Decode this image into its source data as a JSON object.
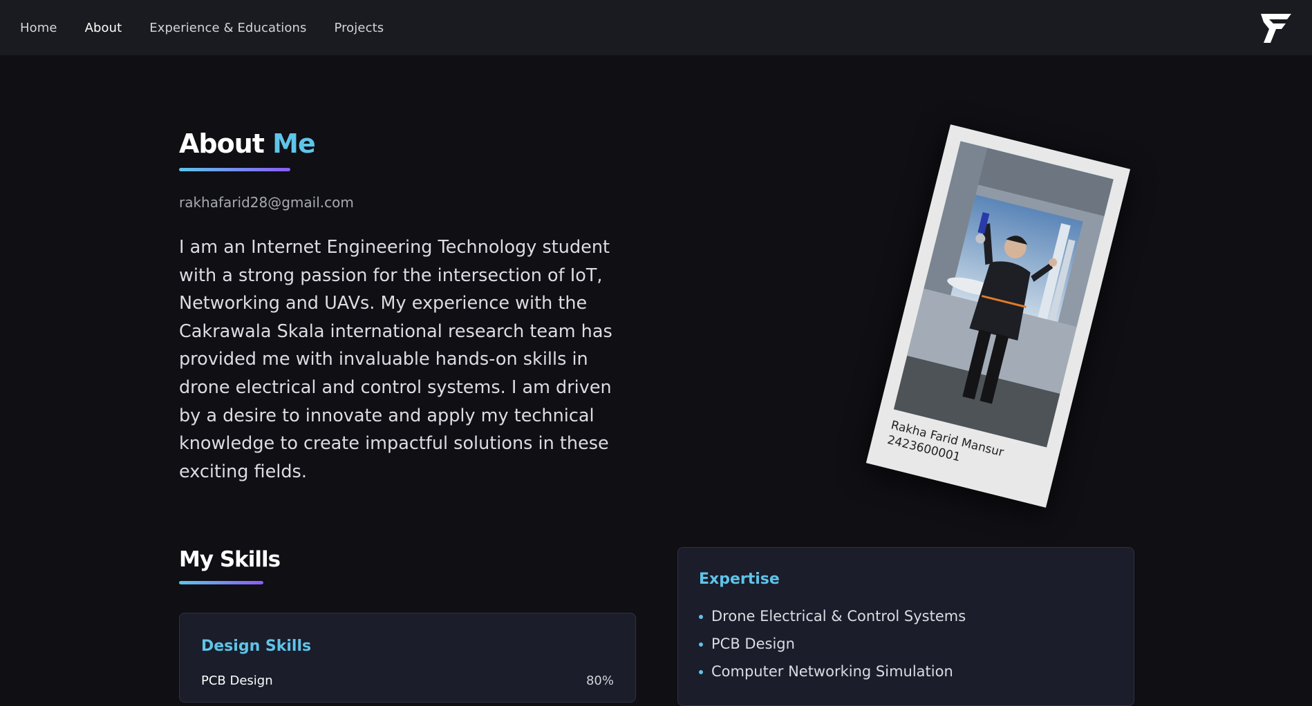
{
  "nav": {
    "links": [
      "Home",
      "About",
      "Experience & Educations",
      "Projects"
    ],
    "active": "About"
  },
  "logo": {
    "icon": "f-logo-icon"
  },
  "about": {
    "title_part1": "About",
    "title_part2": "Me",
    "email": "rakhafarid28@gmail.com",
    "bio": "I am an Internet Engineering Technology student with a strong passion for the intersection of IoT, Networking and UAVs. My experience with the Cakrawala Skala international research team has provided me with invaluable hands-on skills in drone electrical and control systems. I am driven by a desire to innovate and apply my technical knowledge to create impactful solutions in these exciting fields."
  },
  "photo": {
    "name": "Rakha Farid Mansur",
    "id_number": "2423600001"
  },
  "skills": {
    "title": "My Skills",
    "design_card": {
      "title": "Design Skills",
      "items": [
        {
          "name": "PCB Design",
          "percent": "80%"
        }
      ]
    }
  },
  "expertise": {
    "title": "Expertise",
    "items": [
      "Drone Electrical & Control Systems",
      "PCB Design",
      "Computer Networking Simulation"
    ]
  },
  "colors": {
    "accent": "#5fc4e8",
    "gradient_end": "#8b5cf6",
    "background": "#0f0f14",
    "navbar": "#1a1b20",
    "card": "#1b1d2b"
  }
}
